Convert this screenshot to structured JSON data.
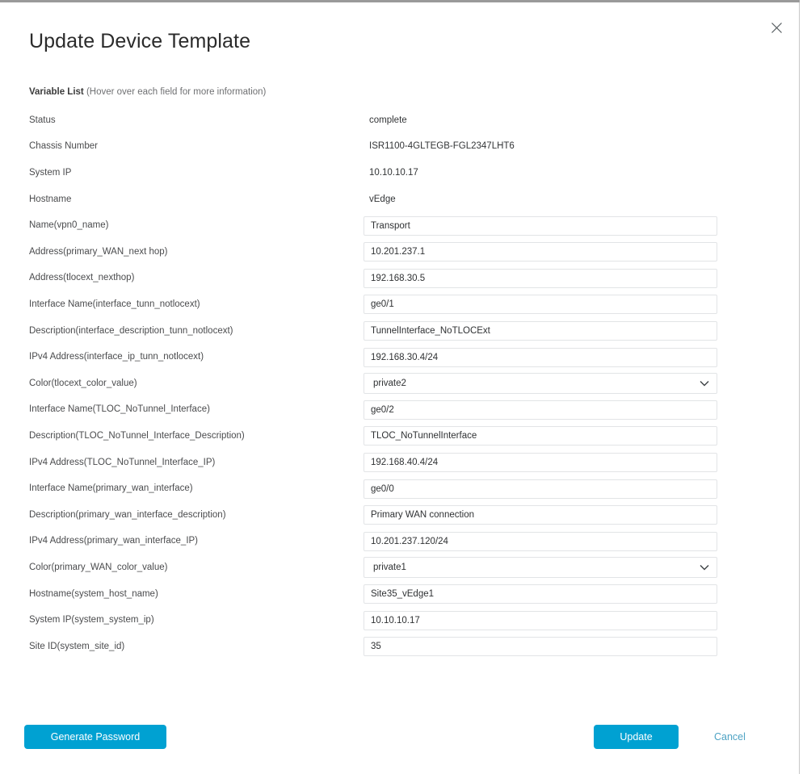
{
  "window": {
    "title": "Update Device Template",
    "close_icon": "close-icon"
  },
  "variable_list": {
    "heading": "Variable List",
    "hint": " (Hover over each field for more information)"
  },
  "rows": [
    {
      "label": "Status",
      "type": "static",
      "value": "complete"
    },
    {
      "label": "Chassis Number",
      "type": "static",
      "value": "ISR1100-4GLTEGB-FGL2347LHT6"
    },
    {
      "label": "System IP",
      "type": "static",
      "value": "10.10.10.17"
    },
    {
      "label": "Hostname",
      "type": "static",
      "value": "vEdge"
    },
    {
      "label": "Name(vpn0_name)",
      "type": "input",
      "value": "Transport"
    },
    {
      "label": "Address(primary_WAN_next hop)",
      "type": "input",
      "value": "10.201.237.1"
    },
    {
      "label": "Address(tlocext_nexthop)",
      "type": "input",
      "value": "192.168.30.5"
    },
    {
      "label": "Interface Name(interface_tunn_notlocext)",
      "type": "input",
      "value": "ge0/1"
    },
    {
      "label": "Description(interface_description_tunn_notlocext)",
      "type": "input",
      "value": "TunnelInterface_NoTLOCExt"
    },
    {
      "label": "IPv4 Address(interface_ip_tunn_notlocext)",
      "type": "input",
      "value": "192.168.30.4/24"
    },
    {
      "label": "Color(tlocext_color_value)",
      "type": "select",
      "value": "private2",
      "icon": "chevron-down-icon"
    },
    {
      "label": "Interface Name(TLOC_NoTunnel_Interface)",
      "type": "input",
      "value": "ge0/2"
    },
    {
      "label": "Description(TLOC_NoTunnel_Interface_Description)",
      "type": "input",
      "value": "TLOC_NoTunnelInterface"
    },
    {
      "label": "IPv4 Address(TLOC_NoTunnel_Interface_IP)",
      "type": "input",
      "value": "192.168.40.4/24"
    },
    {
      "label": "Interface Name(primary_wan_interface)",
      "type": "input",
      "value": "ge0/0"
    },
    {
      "label": "Description(primary_wan_interface_description)",
      "type": "input",
      "value": "Primary WAN connection"
    },
    {
      "label": "IPv4 Address(primary_wan_interface_IP)",
      "type": "input",
      "value": "10.201.237.120/24"
    },
    {
      "label": "Color(primary_WAN_color_value)",
      "type": "select",
      "value": "private1",
      "icon": "chevron-down-icon"
    },
    {
      "label": "Hostname(system_host_name)",
      "type": "input",
      "value": "Site35_vEdge1"
    },
    {
      "label": "System IP(system_system_ip)",
      "type": "input",
      "value": "10.10.10.17"
    },
    {
      "label": "Site ID(system_site_id)",
      "type": "input",
      "value": "35"
    }
  ],
  "footer": {
    "generate_password": "Generate Password",
    "update": "Update",
    "cancel": "Cancel"
  },
  "colors": {
    "primary_button": "#00a1d2",
    "cancel_link": "#4ea3c4",
    "field_border": "#e2e4e6",
    "label_text": "#4a4b4d"
  }
}
